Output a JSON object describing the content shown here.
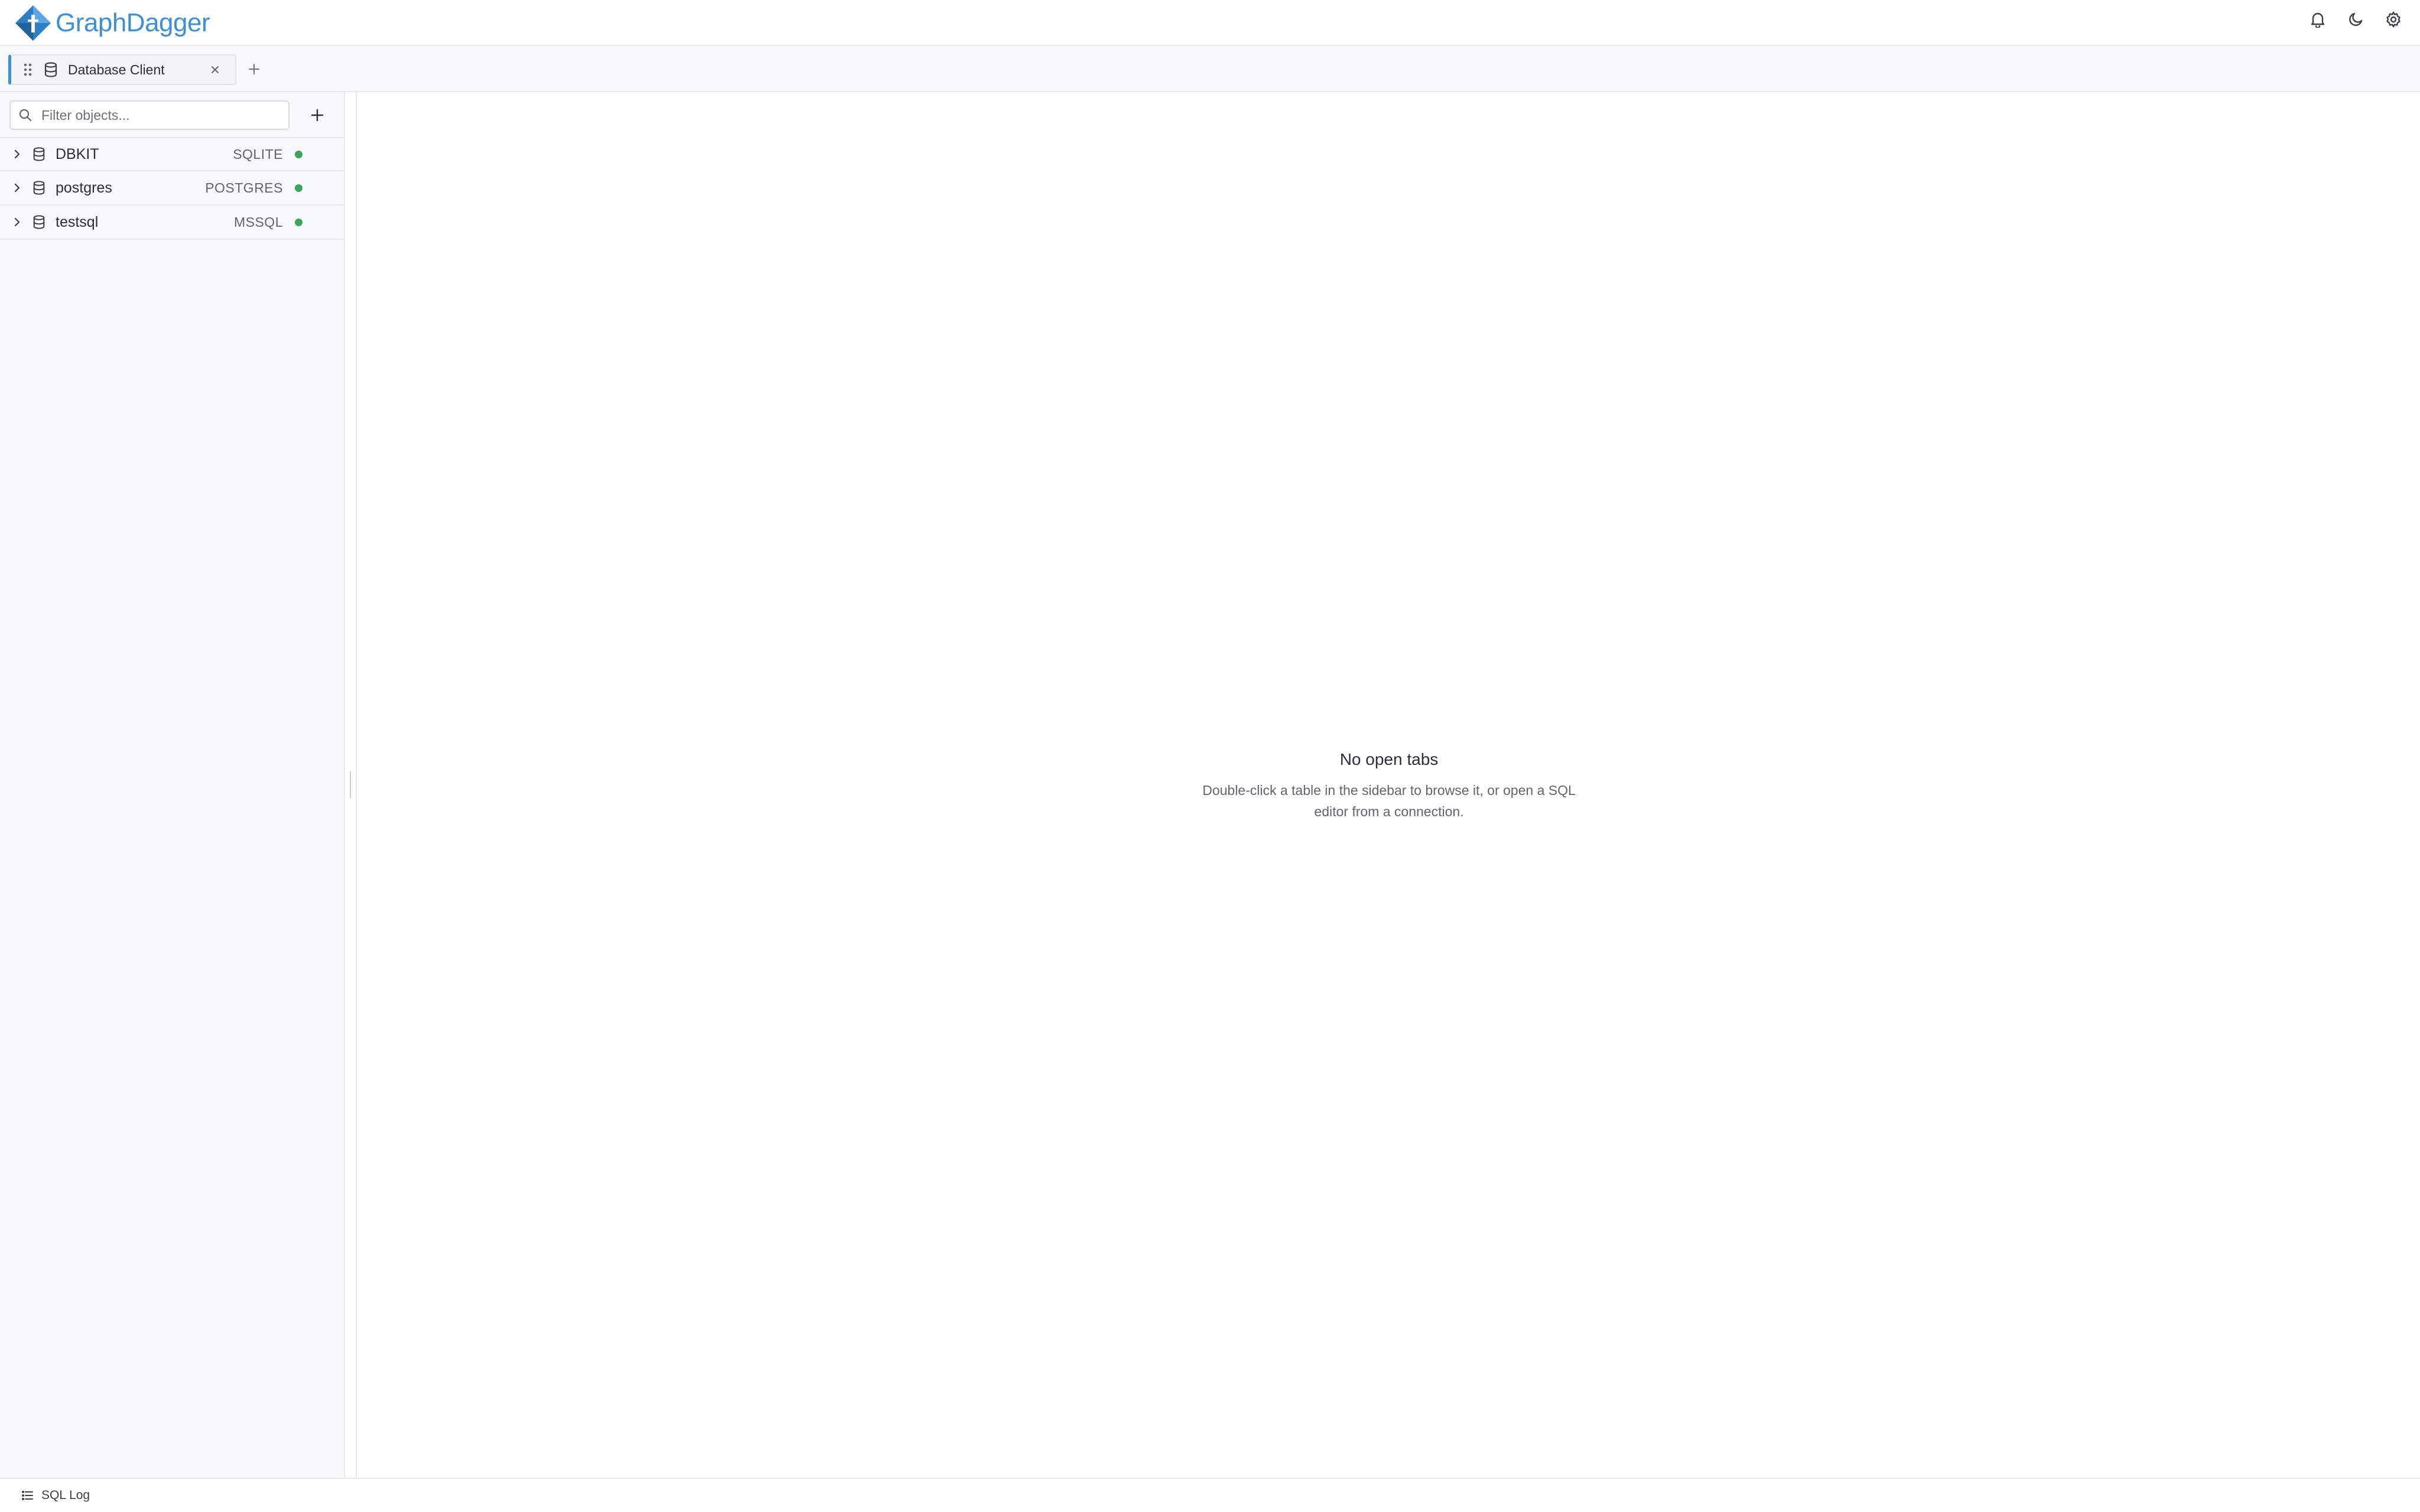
{
  "app": {
    "name": "GraphDagger"
  },
  "header": {
    "icons": [
      "bell-icon",
      "moon-icon",
      "gear-icon"
    ]
  },
  "tabs": {
    "items": [
      {
        "label": "Database Client",
        "icon": "database-icon"
      }
    ],
    "new_tab_icon": "plus-icon"
  },
  "sidebar": {
    "filter_placeholder": "Filter objects...",
    "filter_value": "",
    "add_icon": "plus-icon",
    "connections": [
      {
        "name": "DBKIT",
        "type": "SQLITE",
        "status_color": "#3aa55b"
      },
      {
        "name": "postgres",
        "type": "POSTGRES",
        "status_color": "#3aa55b"
      },
      {
        "name": "testsql",
        "type": "MSSQL",
        "status_color": "#3aa55b"
      }
    ]
  },
  "main": {
    "empty_title": "No open tabs",
    "empty_desc_line1": "Double-click a table in the sidebar to browse it, or open a SQL",
    "empty_desc_line2": "editor from a connection."
  },
  "footer": {
    "label": "SQL Log",
    "icon": "list-icon"
  },
  "colors": {
    "accent": "#3d8fd6",
    "status_ok": "#3aa55b"
  }
}
